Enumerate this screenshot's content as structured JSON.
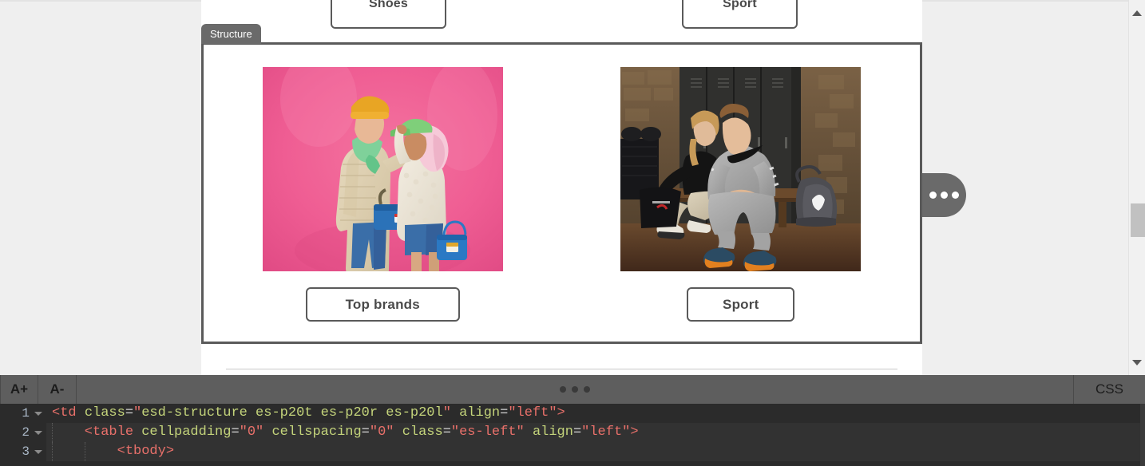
{
  "app": {
    "canvas_bg": "#efefef",
    "toolbar_bg": "#5e5e5e",
    "editor_bg": "#2b2b2b",
    "selection_color": "#5a5a5a"
  },
  "canvas": {
    "structure_tab_label": "Structure",
    "top_row": {
      "buttons": [
        {
          "label": "Shoes",
          "name": "shoes"
        },
        {
          "label": "Sport",
          "name": "sport-top"
        }
      ]
    },
    "structure_block": {
      "columns": [
        {
          "image_name": "fashion-couple-pink-photo",
          "image_alt": "Two models in puffer jackets on a pink background",
          "button_label": "Top brands"
        },
        {
          "image_name": "nike-sportswear-lockerroom-photo",
          "image_alt": "Two models in Nike sportswear seated in a locker room",
          "button_label": "Sport"
        }
      ]
    },
    "ellipsis_handle": {
      "name": "block-options-handle",
      "dots": 3
    }
  },
  "scrollbar": {
    "up_arrow": "scroll-up-arrow",
    "down_arrow": "scroll-down-arrow",
    "thumb": "scroll-thumb"
  },
  "toolbar": {
    "font_increase_label": "A+",
    "font_decrease_label": "A-",
    "drag_handle_name": "panel-drag-handle",
    "css_label": "CSS"
  },
  "code_editor": {
    "lines": [
      {
        "number": "1",
        "tokens": [
          {
            "t": "tag",
            "v": "<td "
          },
          {
            "t": "attr",
            "v": "class"
          },
          {
            "t": "plain",
            "v": "="
          },
          {
            "t": "str",
            "v": "\""
          },
          {
            "t": "attr",
            "v": "esd-structure es-p20t es-p20r es-p20l"
          },
          {
            "t": "str",
            "v": "\" "
          },
          {
            "t": "attr",
            "v": "align"
          },
          {
            "t": "plain",
            "v": "="
          },
          {
            "t": "str",
            "v": "\"left\""
          },
          {
            "t": "tag",
            "v": ">"
          }
        ],
        "indent": 0
      },
      {
        "number": "2",
        "tokens": [
          {
            "t": "tag",
            "v": "    <table "
          },
          {
            "t": "attr",
            "v": "cellpadding"
          },
          {
            "t": "plain",
            "v": "="
          },
          {
            "t": "str",
            "v": "\"0\" "
          },
          {
            "t": "attr",
            "v": "cellspacing"
          },
          {
            "t": "plain",
            "v": "="
          },
          {
            "t": "str",
            "v": "\"0\" "
          },
          {
            "t": "attr",
            "v": "class"
          },
          {
            "t": "plain",
            "v": "="
          },
          {
            "t": "str",
            "v": "\"es-left\" "
          },
          {
            "t": "attr",
            "v": "align"
          },
          {
            "t": "plain",
            "v": "="
          },
          {
            "t": "str",
            "v": "\"left\""
          },
          {
            "t": "tag",
            "v": ">"
          }
        ],
        "indent": 1
      },
      {
        "number": "3",
        "tokens": [
          {
            "t": "tag",
            "v": "        <tbody>"
          }
        ],
        "indent": 2
      }
    ]
  }
}
